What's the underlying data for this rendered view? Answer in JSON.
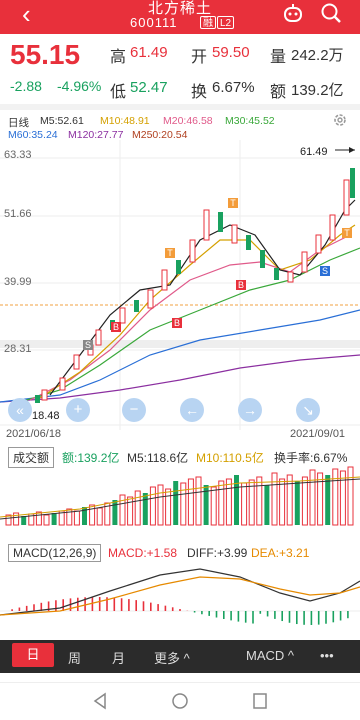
{
  "header": {
    "back_icon": "chevron-left-icon",
    "name": "北方稀土",
    "code": "600111",
    "tags": [
      "融",
      "L2"
    ]
  },
  "quote": {
    "price": "55.15",
    "change": "-2.88",
    "change_pct": "-4.96%",
    "high_label": "高",
    "high": "61.49",
    "low_label": "低",
    "low": "52.47",
    "open_label": "开",
    "open": "59.50",
    "turnover_label": "换",
    "turnover": "6.67%",
    "volume_label": "量",
    "volume": "242.2万",
    "amount_label": "额",
    "amount": "139.2亿"
  },
  "kline": {
    "period": "日线",
    "ma_row1": [
      "M5:52.61",
      "M10:48.91",
      "M20:46.58",
      "M30:45.52"
    ],
    "ma_row2": [
      "M60:35.24",
      "M120:27.77",
      "M250:20.54"
    ],
    "y_ticks": [
      "63.33",
      "51.66",
      "39.99",
      "28.31"
    ],
    "max_label": "61.49",
    "min_label": "18.48",
    "date_start": "2021/06/18",
    "date_end": "2021/09/01",
    "markers": [
      "B",
      "B",
      "B",
      "B",
      "T",
      "T",
      "T",
      "B",
      "B",
      "B",
      "S",
      "S",
      "B",
      "T"
    ]
  },
  "volume_panel": {
    "tab": "成交额",
    "amount": "额:139.2亿",
    "ma5": "M5:118.6亿",
    "ma10": "M10:110.5亿",
    "turnover": "换手率:6.67%"
  },
  "macd_panel": {
    "tab": "MACD(12,26,9)",
    "macd": "MACD:+1.58",
    "diff": "DIFF:+3.99",
    "dea": "DEA:+3.21"
  },
  "tabs": {
    "day": "日",
    "week": "周",
    "month": "月",
    "more": "更多 ^",
    "indicator": "MACD ^",
    "menu": "•••"
  },
  "colors": {
    "red": "#e8303b",
    "green": "#19a15f"
  }
}
